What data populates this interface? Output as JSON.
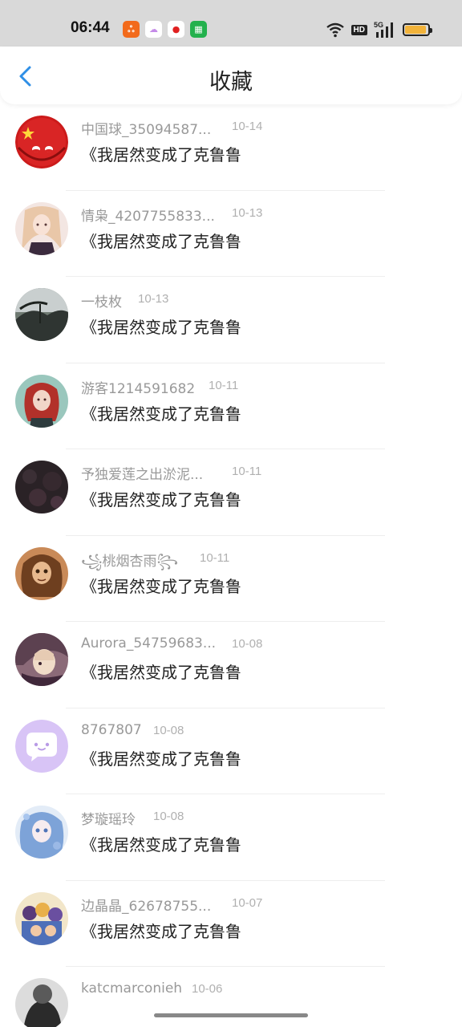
{
  "status_bar": {
    "time": "06:44",
    "network": "5G",
    "hd_label": "HD",
    "apps": [
      {
        "icon": "kuaishou-app-icon",
        "glyph": "ஃ"
      },
      {
        "icon": "cloud-app-icon",
        "glyph": "☁"
      },
      {
        "icon": "red-app-icon",
        "glyph": "●"
      },
      {
        "icon": "green-app-icon",
        "glyph": "▦"
      }
    ]
  },
  "header": {
    "title": "收藏",
    "back_icon": "chevron-left-icon",
    "accent_color": "#2f8fe6"
  },
  "items": [
    {
      "author": "中国球_35094587...",
      "date": "10-14",
      "book": "《我居然变成了克鲁鲁"
    },
    {
      "author": "情枭_4207755833...",
      "date": "10-13",
      "book": "《我居然变成了克鲁鲁"
    },
    {
      "author": "一枝枚",
      "date": "10-13",
      "book": "《我居然变成了克鲁鲁"
    },
    {
      "author": "游客1214591682",
      "date": "10-11",
      "book": "《我居然变成了克鲁鲁"
    },
    {
      "author": "予独爱莲之出淤泥...",
      "date": "10-11",
      "book": "《我居然变成了克鲁鲁"
    },
    {
      "author": "꧁桃烟杏雨꧂",
      "date": "10-11",
      "book": "《我居然变成了克鲁鲁"
    },
    {
      "author": "Aurora_54759683...",
      "date": "10-08",
      "book": "《我居然变成了克鲁鲁"
    },
    {
      "author": "8767807",
      "date": "10-08",
      "book": "《我居然变成了克鲁鲁"
    },
    {
      "author": "梦璇瑶玲",
      "date": "10-08",
      "book": "《我居然变成了克鲁鲁"
    },
    {
      "author": "边晶晶_62678755...",
      "date": "10-07",
      "book": "《我居然变成了克鲁鲁"
    },
    {
      "author": "katcmarconieh",
      "date": "10-06",
      "book": ""
    }
  ]
}
